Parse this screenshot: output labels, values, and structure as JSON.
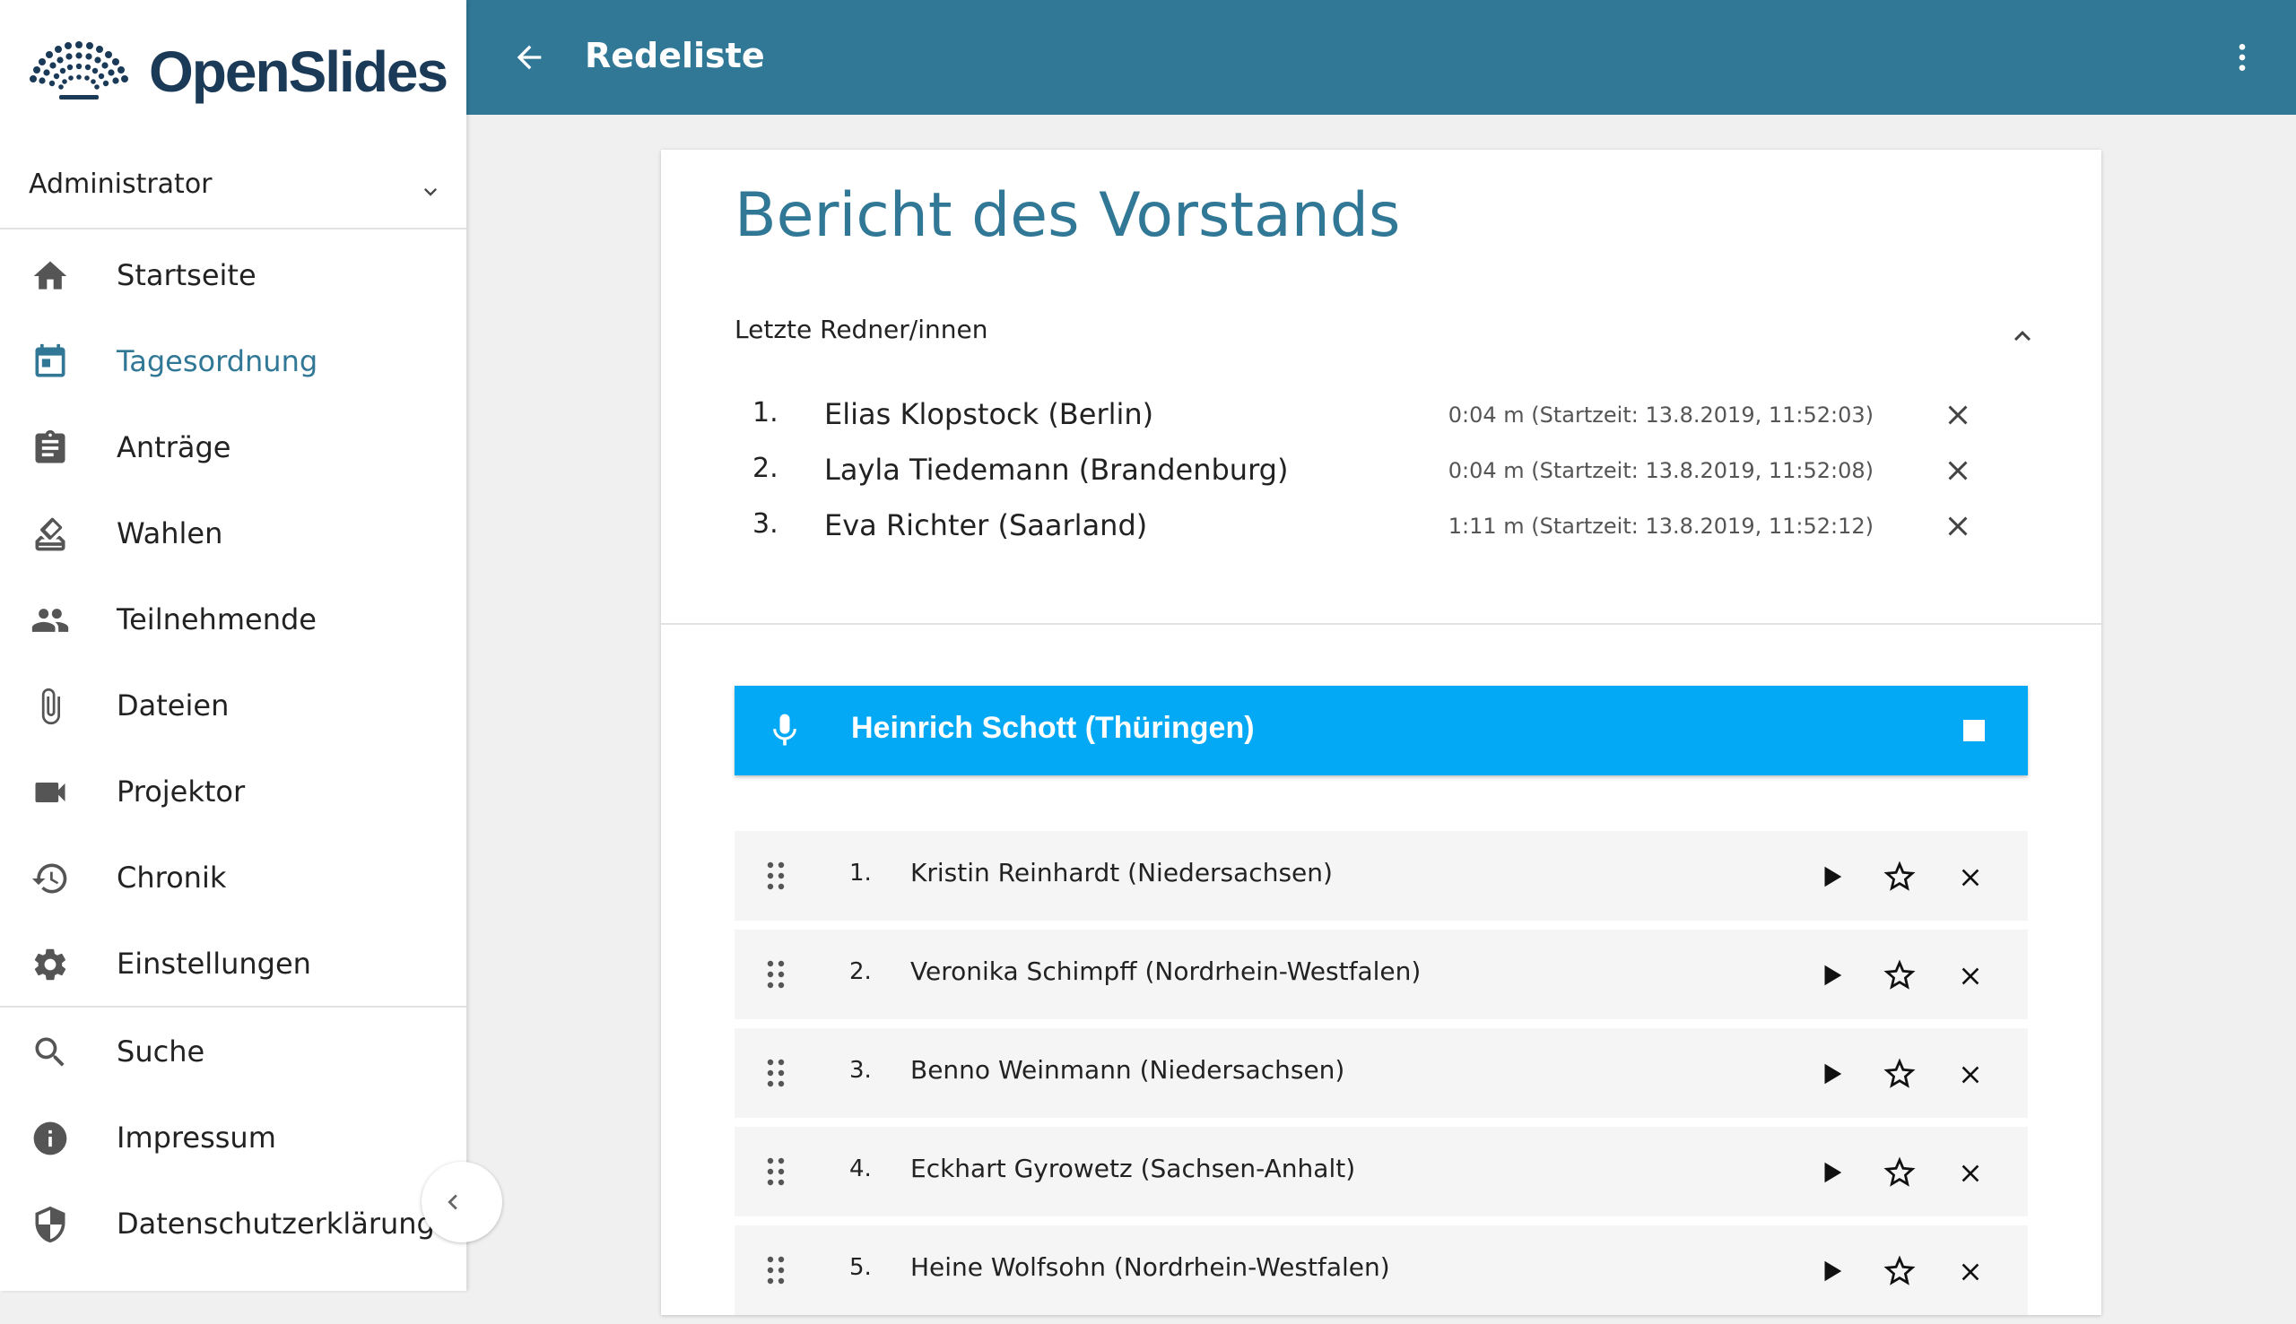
{
  "app": {
    "name": "OpenSlides"
  },
  "user": {
    "name": "Administrator"
  },
  "nav": {
    "items": [
      {
        "label": "Startseite",
        "icon": "home-icon"
      },
      {
        "label": "Tagesordnung",
        "icon": "calendar-icon",
        "active": true
      },
      {
        "label": "Anträge",
        "icon": "clipboard-icon"
      },
      {
        "label": "Wahlen",
        "icon": "ballot-icon"
      },
      {
        "label": "Teilnehmende",
        "icon": "people-icon"
      },
      {
        "label": "Dateien",
        "icon": "paperclip-icon"
      },
      {
        "label": "Projektor",
        "icon": "videocam-icon"
      },
      {
        "label": "Chronik",
        "icon": "history-icon"
      },
      {
        "label": "Einstellungen",
        "icon": "gear-icon"
      }
    ],
    "secondary": [
      {
        "label": "Suche",
        "icon": "search-icon"
      },
      {
        "label": "Impressum",
        "icon": "info-icon"
      },
      {
        "label": "Datenschutzerklärung",
        "icon": "shield-icon"
      }
    ]
  },
  "toolbar": {
    "title": "Redeliste"
  },
  "agenda": {
    "title": "Bericht des Vorstands"
  },
  "last_speakers": {
    "label": "Letzte Redner/innen",
    "items": [
      {
        "num": "1.",
        "name": "Elias Klopstock (Berlin)",
        "time": "0:04 m (Startzeit: 13.8.2019, 11:52:03)"
      },
      {
        "num": "2.",
        "name": "Layla Tiedemann (Brandenburg)",
        "time": "0:04 m (Startzeit: 13.8.2019, 11:52:08)"
      },
      {
        "num": "3.",
        "name": "Eva Richter (Saarland)",
        "time": "1:11 m (Startzeit: 13.8.2019, 11:52:12)"
      }
    ]
  },
  "current_speaker": {
    "name": "Heinrich Schott (Thüringen)"
  },
  "queue": [
    {
      "num": "1.",
      "name": "Kristin Reinhardt (Niedersachsen)"
    },
    {
      "num": "2.",
      "name": "Veronika Schimpff (Nordrhein-Westfalen)"
    },
    {
      "num": "3.",
      "name": "Benno Weinmann (Niedersachsen)"
    },
    {
      "num": "4.",
      "name": "Eckhart Gyrowetz (Sachsen-Anhalt)"
    },
    {
      "num": "5.",
      "name": "Heine Wolfsohn (Nordrhein-Westfalen)"
    }
  ],
  "colors": {
    "primary": "#317796",
    "accent": "#03a9f4",
    "logo": "#1b3a57"
  }
}
